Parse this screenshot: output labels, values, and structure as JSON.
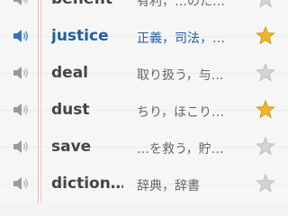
{
  "vocab_list": {
    "rows": [
      {
        "word": "benefit",
        "meaning": "有利，…のた…",
        "active": false,
        "starred": false
      },
      {
        "word": "justice",
        "meaning": "正義，司法，…",
        "active": true,
        "starred": true
      },
      {
        "word": "deal",
        "meaning": "取り扱う，与…",
        "active": false,
        "starred": false
      },
      {
        "word": "dust",
        "meaning": "ちり，ほこり…",
        "active": false,
        "starred": true
      },
      {
        "word": "save",
        "meaning": "…を救う，貯…",
        "active": false,
        "starred": false
      },
      {
        "word": "diction…",
        "meaning": "辞典，辞書",
        "active": false,
        "starred": false
      }
    ]
  },
  "colors": {
    "active_text": "#1f5f9e",
    "star_filled": "#f0b626",
    "star_empty": "#d4d4d4",
    "margin_line": "#e9b7b7"
  },
  "icons": {
    "speaker": "speaker-icon",
    "star": "star-icon"
  }
}
